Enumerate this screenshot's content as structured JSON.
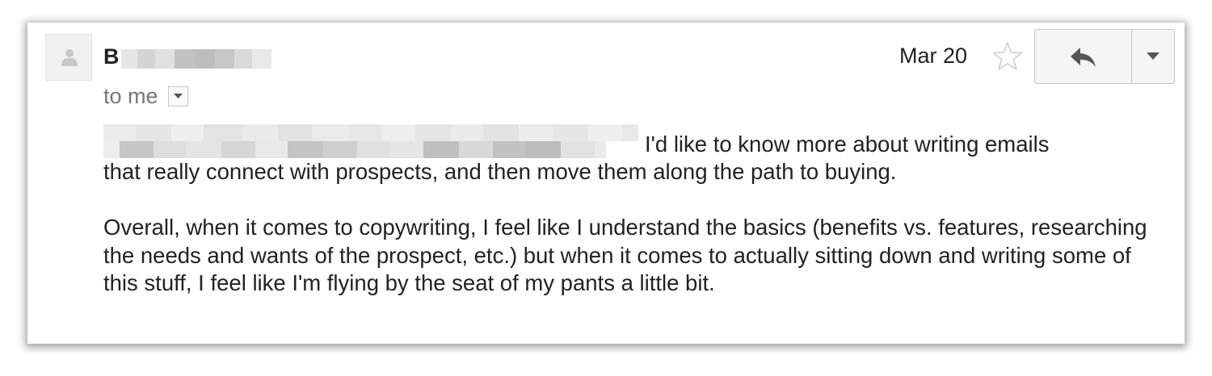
{
  "email": {
    "sender_visible_initial": "B",
    "recipient_text": "to me",
    "date": "Mar 20",
    "icons": {
      "avatar": "person-silhouette-icon",
      "star": "star-outline-icon",
      "reply": "reply-arrow-icon",
      "more": "caret-down-icon",
      "recipient_details": "caret-down-small-icon"
    },
    "body": {
      "first_line_after_redaction": "I'd like to know more about writing emails",
      "first_paragraph_rest": "that really connect with prospects, and then move them along the path to buying.",
      "second_paragraph": "Overall, when it comes to copywriting, I feel like I understand the basics (benefits vs. features, researching the needs and wants of the prospect, etc.) but when it comes to actually sitting down and writing some of this stuff, I feel like I'm flying by the seat of my pants a little bit."
    }
  },
  "colors": {
    "text_primary": "#222222",
    "text_secondary": "#777777",
    "button_background": "#f5f5f5",
    "button_border": "#c6c6c6",
    "redaction_light": "#e4e4e4",
    "redaction_dark": "#bdbdbd"
  }
}
